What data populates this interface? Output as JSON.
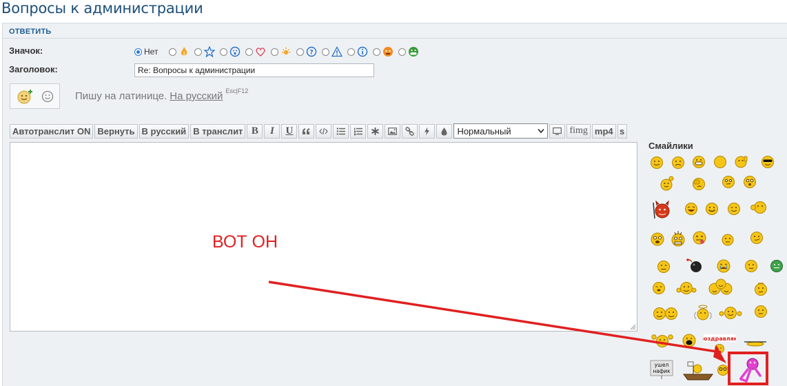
{
  "page": {
    "title": "Вопросы к администрации"
  },
  "reply": {
    "header": "ОТВЕТИТЬ",
    "icon_label": "Значок:",
    "subject_label": "Заголовок:",
    "icon_options": [
      "Нет",
      "fire-icon",
      "star-icon",
      "surprised-icon",
      "heart-icon",
      "sun-icon",
      "question-icon",
      "warning-icon",
      "info-icon",
      "angry-icon",
      "grin-icon"
    ],
    "selected_icon": "Нет",
    "subject_value": "Re: Вопросы к администрации"
  },
  "translit": {
    "status": "Пишу на латинице.",
    "link": "На русский",
    "keys": "Esc|F12"
  },
  "toolbar": {
    "autotranslit": "Автотранслит ON",
    "revert": "Вернуть",
    "to_russian": "В русский",
    "to_translit": "В транслит",
    "bold": "B",
    "italic": "I",
    "underline": "U",
    "font_size": "Нормальный",
    "fimg": "fimg",
    "mp4": "mp4",
    "s": "s"
  },
  "smilies": {
    "title": "Смайлики",
    "badge_text": "поздравляю",
    "sign_text": "ушел нафик"
  },
  "annotation": {
    "text": "ВОТ ОН",
    "color": "#e02020"
  },
  "colors": {
    "title": "#1b4f7a",
    "header": "#1f5d94",
    "panel": "#eef1f4",
    "smiley": "#f5c518"
  }
}
